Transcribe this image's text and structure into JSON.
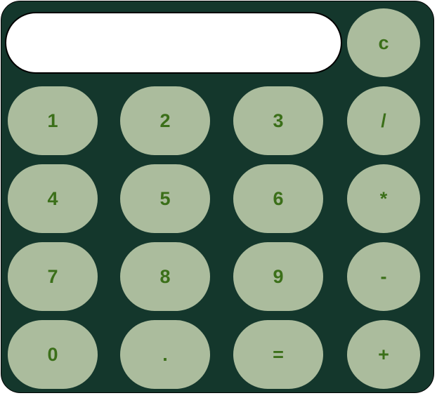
{
  "display": {
    "value": ""
  },
  "keys": {
    "clear": "c",
    "one": "1",
    "two": "2",
    "three": "3",
    "divide": "/",
    "four": "4",
    "five": "5",
    "six": "6",
    "multiply": "*",
    "seven": "7",
    "eight": "8",
    "nine": "9",
    "subtract": "-",
    "zero": "0",
    "decimal": ".",
    "equals": "=",
    "add": "+"
  },
  "colors": {
    "body": "#14372c",
    "key_background": "#abbc9d",
    "key_text": "#3b6f19",
    "display_background": "#ffffff"
  }
}
